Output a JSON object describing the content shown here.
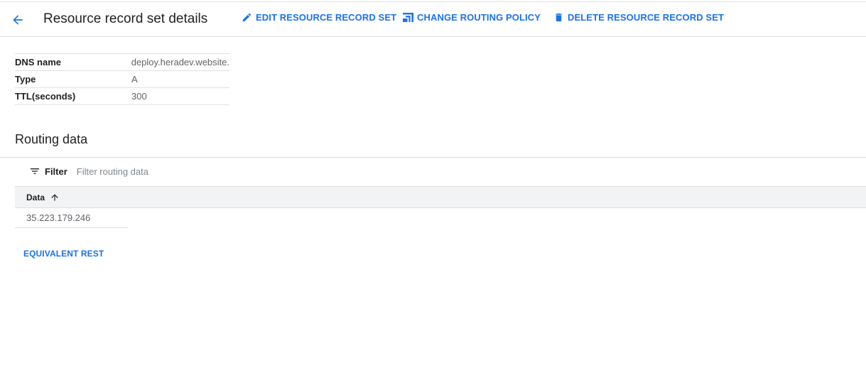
{
  "header": {
    "title": "Resource record set details",
    "back_icon": "arrow-back-icon",
    "actions": {
      "edit": {
        "label": "EDIT RESOURCE RECORD SET",
        "icon": "pencil-icon"
      },
      "routing": {
        "label": "CHANGE ROUTING POLICY",
        "icon": "routing-policy-icon"
      },
      "delete": {
        "label": "DELETE RESOURCE RECORD SET",
        "icon": "trash-icon"
      }
    }
  },
  "details": [
    {
      "key": "DNS name",
      "value": "deploy.heradev.website."
    },
    {
      "key": "Type",
      "value": "A"
    },
    {
      "key": "TTL(seconds)",
      "value": "300"
    }
  ],
  "routing": {
    "title": "Routing data",
    "filter": {
      "label": "Filter",
      "placeholder": "Filter routing data",
      "value": ""
    },
    "table": {
      "columns": [
        {
          "label": "Data",
          "sort": "ascending"
        }
      ],
      "rows": [
        [
          "35.223.179.246"
        ]
      ]
    }
  },
  "footer": {
    "rest_link": "EQUIVALENT REST"
  },
  "colors": {
    "accent": "#1a73e8",
    "text": "#202124",
    "muted": "#5f6368",
    "header_bg": "#f1f3f4",
    "divider": "#dadce0"
  }
}
